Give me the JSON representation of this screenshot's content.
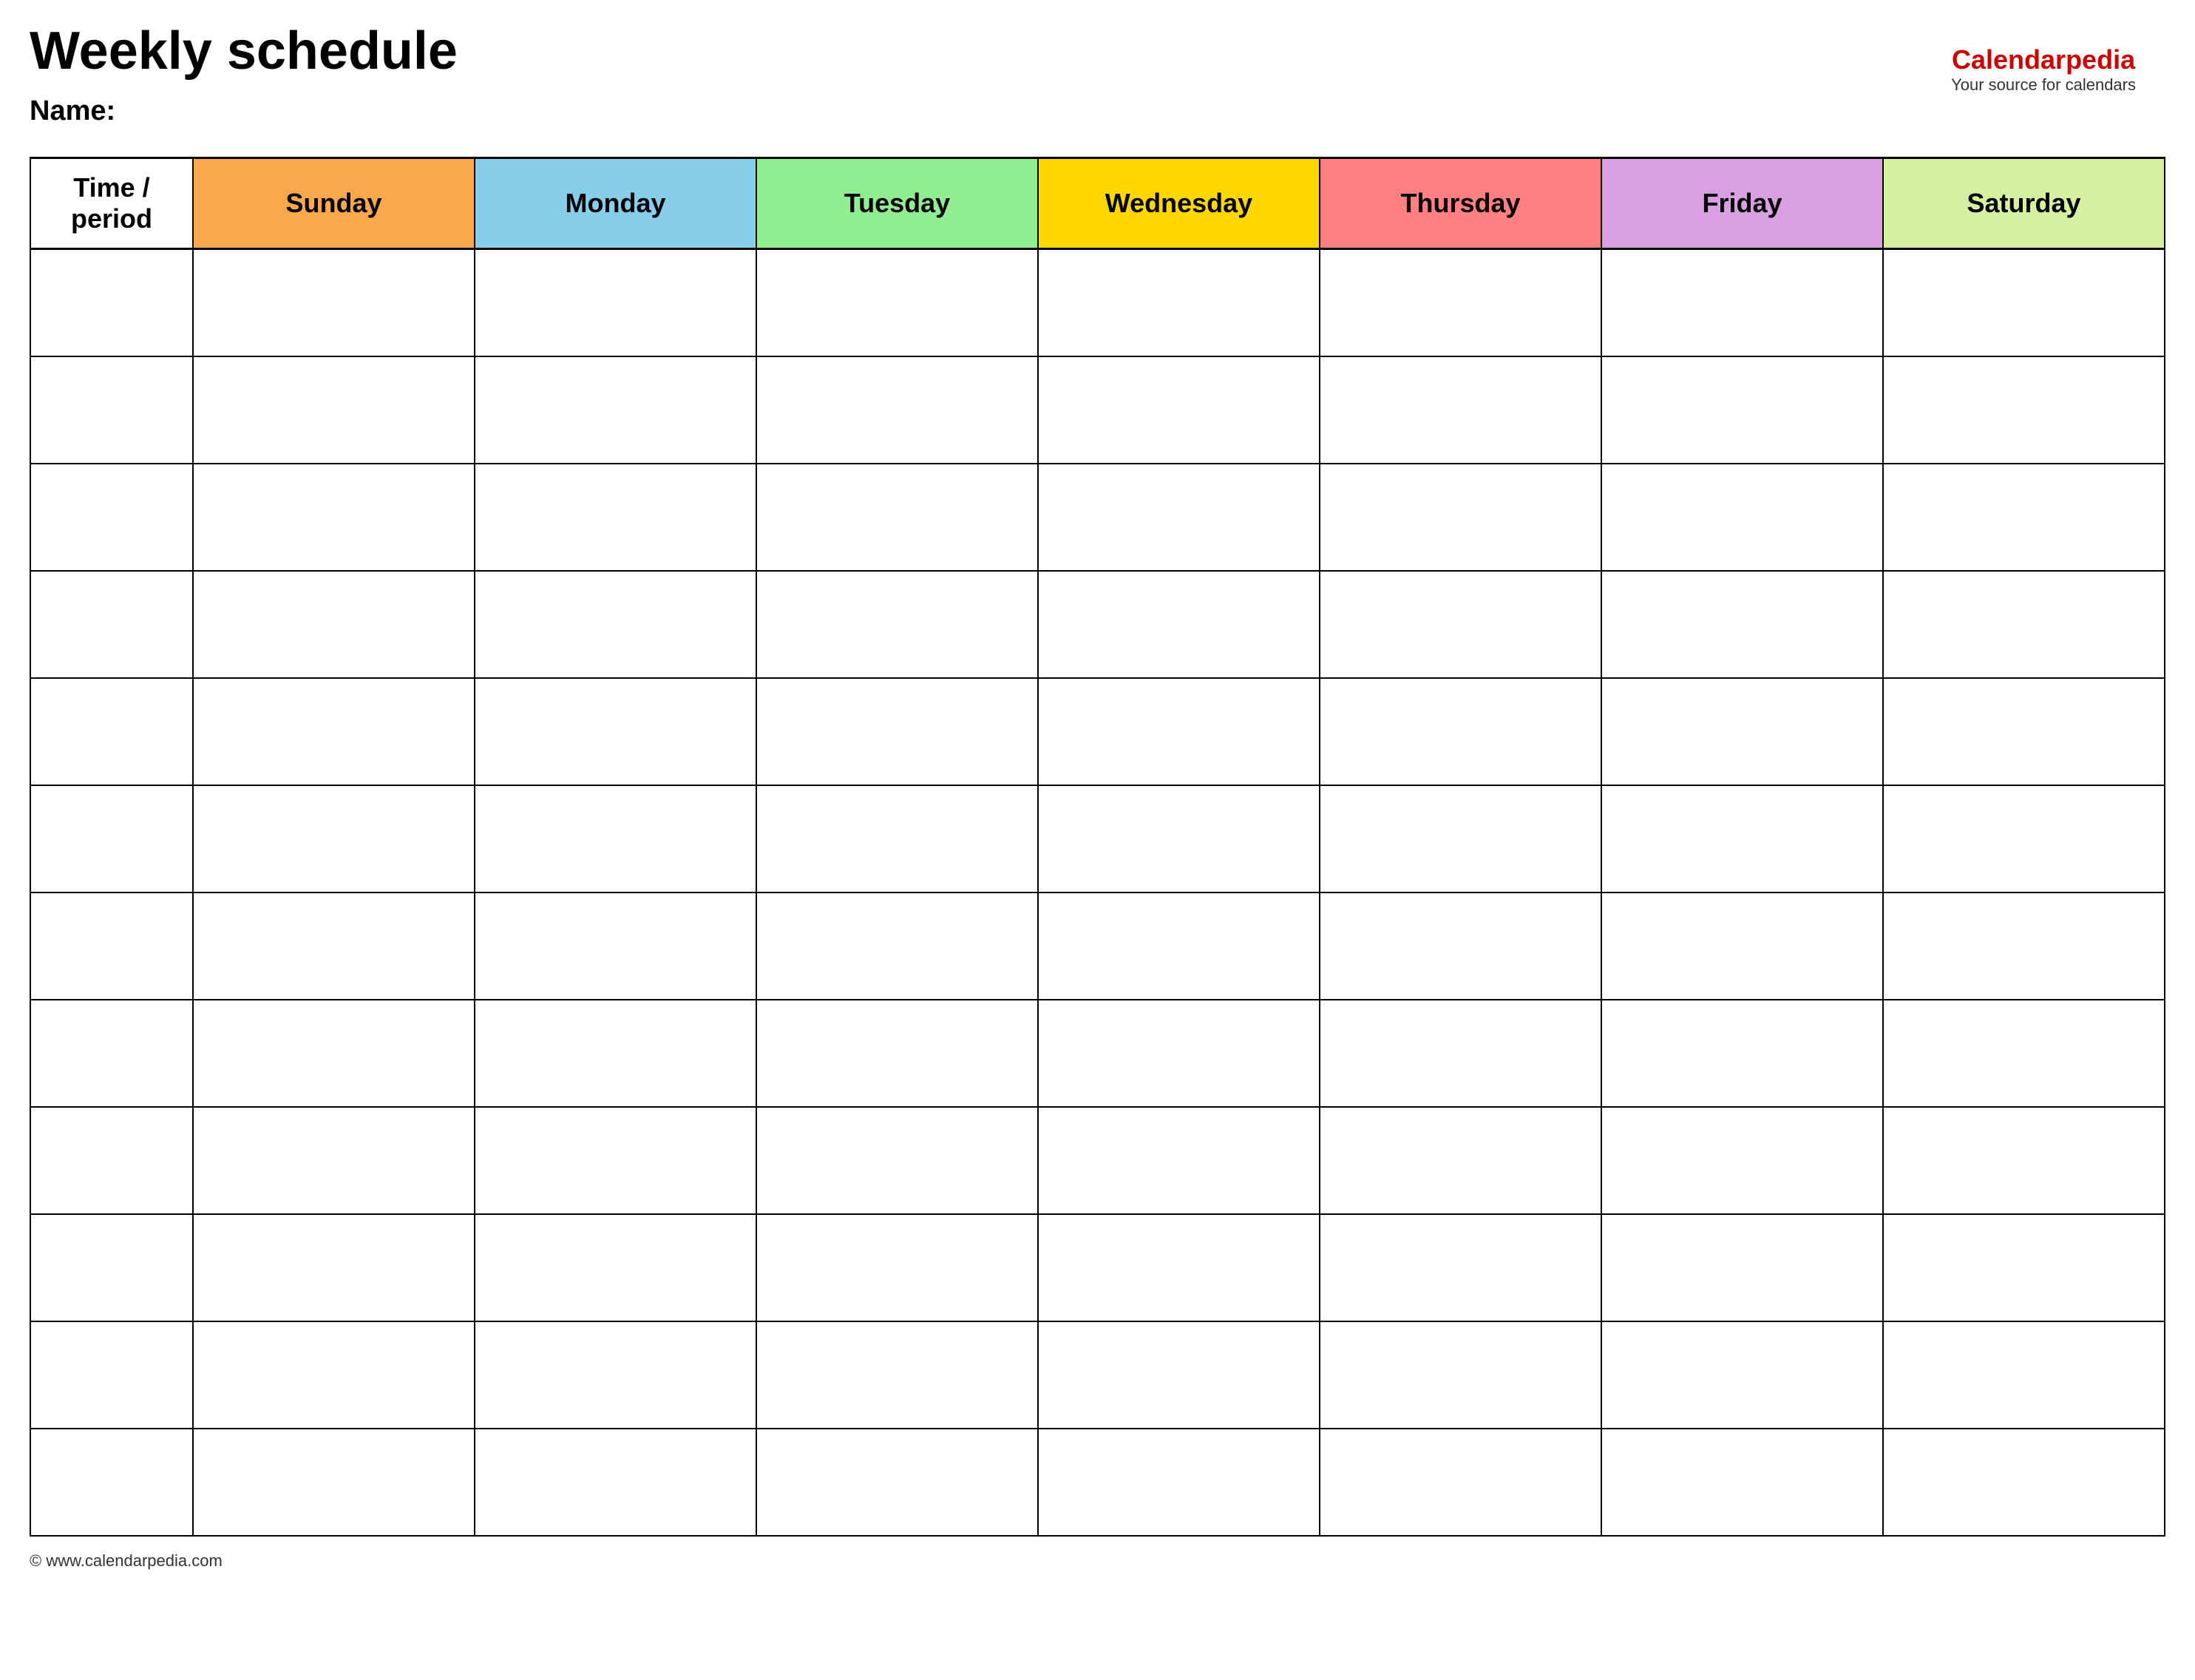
{
  "page": {
    "title": "Weekly schedule",
    "name_label": "Name:",
    "footer": "© www.calendarpedia.com"
  },
  "branding": {
    "name_part1": "Calendar",
    "name_part2": "pedia",
    "tagline": "Your source for calendars"
  },
  "table": {
    "headers": [
      {
        "id": "time",
        "label": "Time / period",
        "color": "#ffffff",
        "class": "col-time"
      },
      {
        "id": "sunday",
        "label": "Sunday",
        "color": "#f9a84d",
        "class": "col-sunday"
      },
      {
        "id": "monday",
        "label": "Monday",
        "color": "#87ceeb",
        "class": "col-monday"
      },
      {
        "id": "tuesday",
        "label": "Tuesday",
        "color": "#90ee90",
        "class": "col-tuesday"
      },
      {
        "id": "wednesday",
        "label": "Wednesday",
        "color": "#ffd700",
        "class": "col-wednesday"
      },
      {
        "id": "thursday",
        "label": "Thursday",
        "color": "#ff8080",
        "class": "col-thursday"
      },
      {
        "id": "friday",
        "label": "Friday",
        "color": "#d8a0e0",
        "class": "col-friday"
      },
      {
        "id": "saturday",
        "label": "Saturday",
        "color": "#d4f0a0",
        "class": "col-saturday"
      }
    ],
    "row_count": 12
  }
}
